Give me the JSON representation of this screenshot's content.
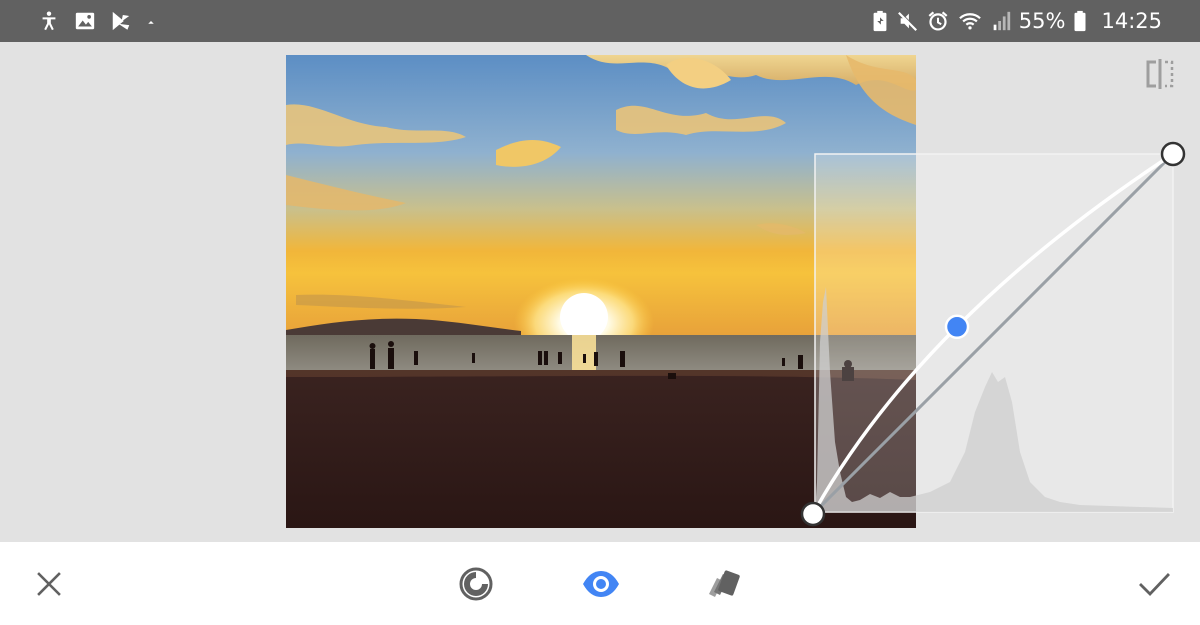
{
  "status_bar": {
    "left_icons": [
      "accessibility-icon",
      "gallery-icon",
      "play-store-icon",
      "dot-icon"
    ],
    "right_icons": [
      "battery-saver-icon",
      "mute-icon",
      "alarm-icon",
      "wifi-icon",
      "signal-icon",
      "battery-icon"
    ],
    "battery_percent": "55%",
    "time": "14:25"
  },
  "editor": {
    "tool": "curves",
    "compare_icon": "compare-icon",
    "curve": {
      "points": [
        {
          "input": 0,
          "output": 0,
          "type": "endpoint"
        },
        {
          "input": 0.4,
          "output": 0.52,
          "type": "control",
          "selected": true
        },
        {
          "input": 1,
          "output": 1,
          "type": "endpoint"
        }
      ],
      "colors": {
        "selected_point": "#4285f4",
        "curve": "#ffffff",
        "diagonal": "#9aa0a6"
      }
    }
  },
  "toolbar": {
    "cancel_icon": "close-icon",
    "presets_icon": "curve-presets-icon",
    "view_icon": "eye-icon",
    "styles_icon": "styles-icon",
    "apply_icon": "checkmark-icon",
    "accent_color": "#4285f4"
  }
}
